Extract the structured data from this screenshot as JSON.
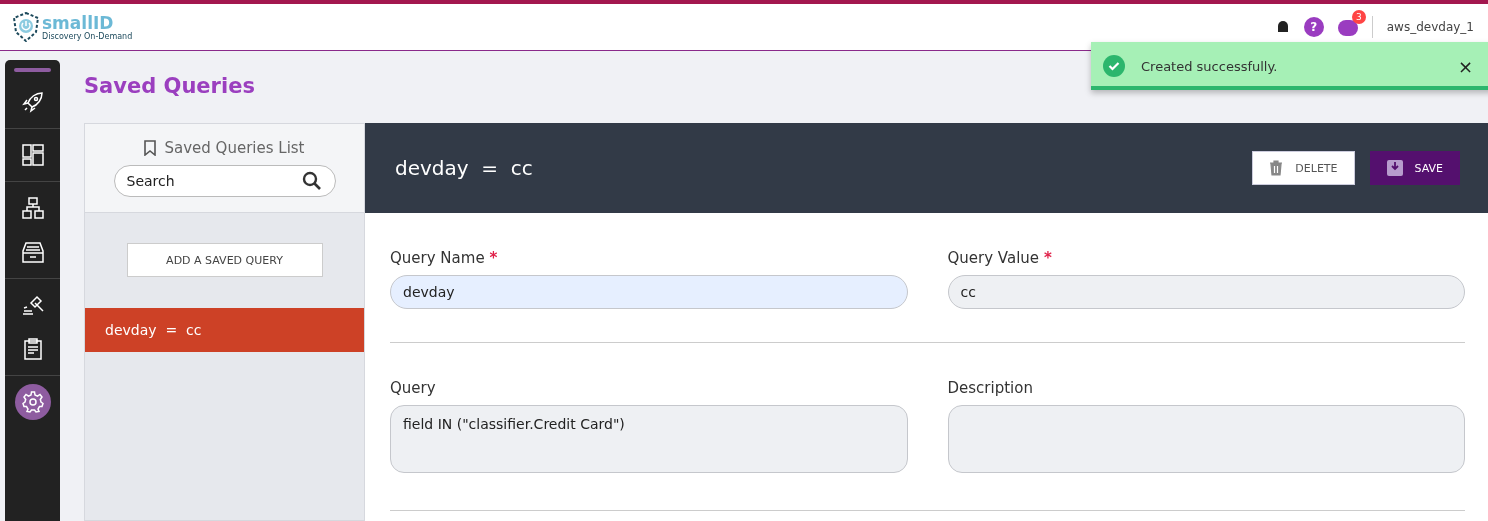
{
  "header": {
    "logo_name": "smallID",
    "logo_tagline": "Discovery On-Demand",
    "help_badge": "?",
    "notifications_count": "3",
    "user": "aws_devday_1"
  },
  "toast": {
    "message": "Created successfully.",
    "close": "×"
  },
  "sidebar": {
    "groups": [
      {
        "items": [
          {
            "kind": "rocket",
            "selected": false
          }
        ]
      },
      {
        "items": [
          {
            "kind": "dashboard",
            "selected": false
          }
        ]
      },
      {
        "items": [
          {
            "kind": "sitemap",
            "selected": false
          },
          {
            "kind": "drawer",
            "selected": false
          }
        ]
      },
      {
        "items": [
          {
            "kind": "gavel",
            "selected": false
          },
          {
            "kind": "clipboard",
            "selected": false
          }
        ]
      },
      {
        "items": [
          {
            "kind": "gear",
            "selected": true
          }
        ]
      }
    ]
  },
  "page_title": "Saved Queries",
  "list": {
    "title": "Saved Queries List",
    "search": {
      "placeholder": "Search"
    },
    "add_button": "ADD A SAVED QUERY",
    "items": [
      {
        "label": "devday  =  cc",
        "selected": true
      }
    ]
  },
  "detail": {
    "title": "devday  =  cc",
    "delete_button": "DELETE",
    "save_button": "SAVE",
    "fields": [
      {
        "kind": "line",
        "label": "Query Name",
        "required_mark": "*",
        "value": "devday",
        "focused": true
      },
      {
        "kind": "line",
        "label": "Query Value",
        "required_mark": "*",
        "value": "cc",
        "focused": false
      },
      {
        "kind": "area",
        "label": "Query",
        "value": "field IN (\"classifier.Credit Card\")",
        "focused": false
      },
      {
        "kind": "area",
        "label": "Description",
        "focused": false
      }
    ]
  }
}
